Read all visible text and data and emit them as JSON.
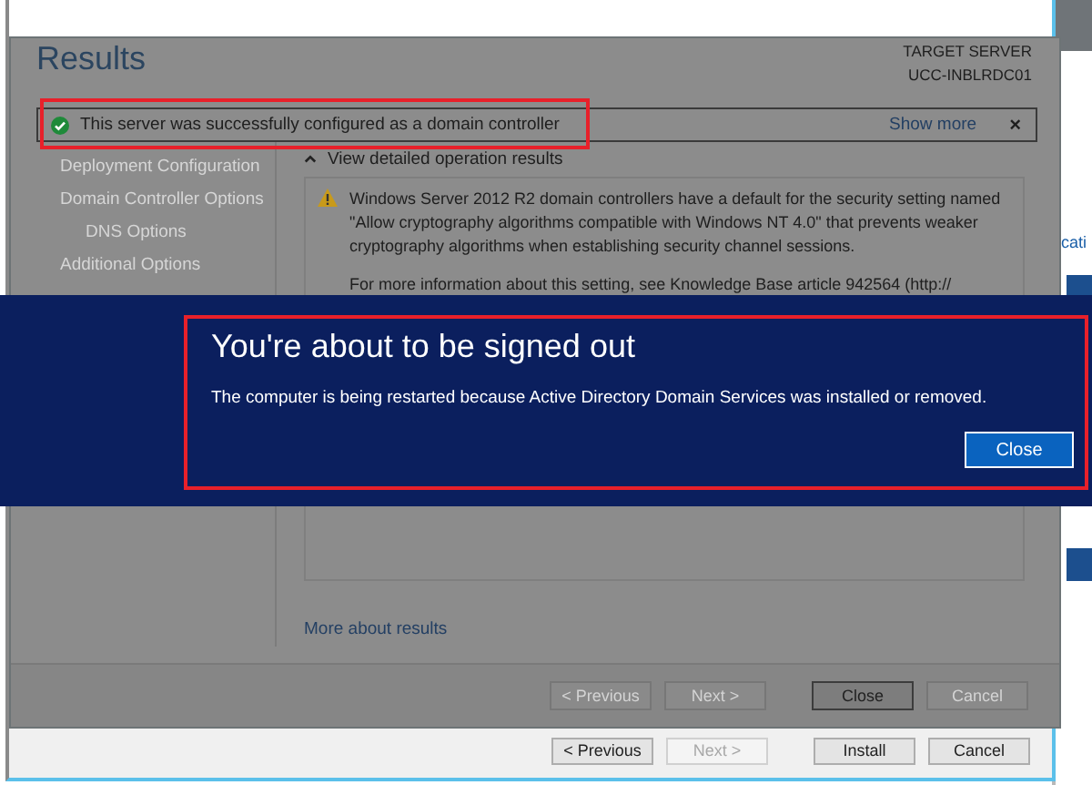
{
  "background_window": {
    "buttons": [
      {
        "label": "< Previous",
        "disabled": false
      },
      {
        "label": "Next >",
        "disabled": true
      },
      {
        "label": "Install",
        "disabled": false
      },
      {
        "label": "Cancel",
        "disabled": false
      }
    ]
  },
  "side_fragment": {
    "text": "cati"
  },
  "wizard": {
    "title": "Results",
    "target_server": {
      "label": "TARGET SERVER",
      "value": "UCC-INBLRDC01"
    },
    "notification": {
      "text": "This server was successfully configured as a domain controller",
      "link": "Show more",
      "close": "×"
    },
    "sidebar": {
      "items": [
        {
          "label": "Deployment Configuration",
          "disabled": true
        },
        {
          "label": "Domain Controller Options",
          "disabled": true,
          "children": [
            {
              "label": "DNS Options",
              "disabled": true
            }
          ]
        },
        {
          "label": "Additional Options",
          "disabled": true
        }
      ]
    },
    "details": {
      "label": "View detailed operation results",
      "expanded": true,
      "messages": [
        {
          "kind": "warning",
          "paragraphs": [
            "Windows Server 2012 R2 domain controllers have a default for the security setting named \"Allow cryptography algorithms compatible with Windows NT 4.0\" that prevents weaker cryptography algorithms when establishing security channel sessions.",
            "For more information about this setting, see Knowledge Base article 942564 (http://"
          ]
        }
      ]
    },
    "more_link": "More about results",
    "buttons": [
      {
        "label": "< Previous",
        "disabled": true,
        "default": false
      },
      {
        "label": "Next >",
        "disabled": true,
        "default": false
      },
      {
        "label": "Close",
        "disabled": false,
        "default": true
      },
      {
        "label": "Cancel",
        "disabled": true,
        "default": false
      }
    ]
  },
  "banner": {
    "title": "You're about to be signed out",
    "message": "The computer is being restarted because Active Directory Domain Services was installed or removed.",
    "button": "Close"
  }
}
